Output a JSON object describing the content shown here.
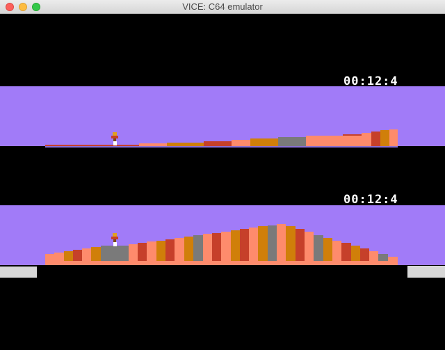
{
  "window": {
    "title": "VICE: C64 emulator"
  },
  "hud": {
    "player1_timer": "00:12:4",
    "player2_timer": "00:12:4"
  },
  "colors": {
    "sky": "#a17bf8",
    "ground": "#fe8b6c",
    "brown": "#d07f0a",
    "red": "#c6402a",
    "grey": "#7a7a7a",
    "black": "#000000",
    "slab": "#d7d7d7"
  },
  "icons": {
    "skier": "skier-sprite-icon",
    "window_close": "close-icon",
    "window_minimize": "minimize-icon",
    "window_maximize": "maximize-icon"
  }
}
